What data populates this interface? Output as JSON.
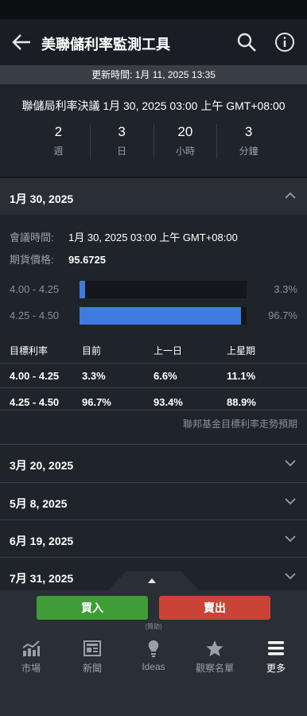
{
  "app": {
    "title": "美聯儲利率監測工具"
  },
  "updated": "更新時間: 1月 11, 2025 13:35",
  "decision": {
    "heading": "聯儲局利率決議 1月 30, 2025 03:00 上午 GMT+08:00",
    "countdown": [
      {
        "value": "2",
        "unit": "週"
      },
      {
        "value": "3",
        "unit": "日"
      },
      {
        "value": "20",
        "unit": "小時"
      },
      {
        "value": "3",
        "unit": "分鐘"
      }
    ]
  },
  "meeting": {
    "date": "1月 30, 2025",
    "time_label": "會議時間:",
    "time_value": "1月 30, 2025 03:00 上午 GMT+08:00",
    "futures_label": "期貨價格:",
    "futures_value": "95.6725",
    "probabilities": [
      {
        "range": "4.00 - 4.25",
        "pct_text": "3.3%",
        "value": 3.3
      },
      {
        "range": "4.25 - 4.50",
        "pct_text": "96.7%",
        "value": 96.7
      }
    ],
    "table": {
      "headers": [
        "目標利率",
        "目前",
        "上一日",
        "上星期"
      ],
      "rows": [
        [
          "4.00 - 4.25",
          "3.3%",
          "6.6%",
          "11.1%"
        ],
        [
          "4.25 - 4.50",
          "96.7%",
          "93.4%",
          "88.9%"
        ]
      ]
    },
    "trend_link": "聯邦基金目標利率走勢預期"
  },
  "other_meetings": [
    "3月 20, 2025",
    "5月 8, 2025",
    "6月 19, 2025",
    "7月 31, 2025"
  ],
  "trade": {
    "buy": "買入",
    "sell": "賣出",
    "sponsor": "(贊助)"
  },
  "nav": [
    {
      "label": "市場",
      "icon": "chart-icon"
    },
    {
      "label": "新聞",
      "icon": "news-icon"
    },
    {
      "label": "Ideas",
      "icon": "lightbulb-icon"
    },
    {
      "label": "觀察名單",
      "icon": "star-icon"
    },
    {
      "label": "更多",
      "icon": "menu-icon",
      "active": true
    }
  ],
  "colors": {
    "bar": "#3d7be0",
    "buy": "#3f9c37",
    "sell": "#c94437",
    "background": "#1f242b"
  }
}
